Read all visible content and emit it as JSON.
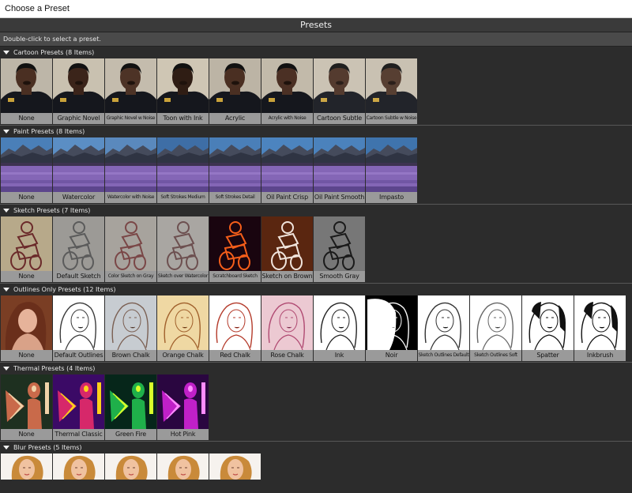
{
  "window": {
    "title": "Choose a Preset"
  },
  "panel": {
    "title": "Presets",
    "hint": "Double-click to select a preset."
  },
  "sections": [
    {
      "title": "Cartoon Presets (8 Items)",
      "items": [
        "None",
        "Graphic Novel",
        "Graphic Novel w Noise",
        "Toon with Ink",
        "Acrylic",
        "Acrylic with Noise",
        "Cartoon Subtle",
        "Cartoon Subtle w Noise"
      ]
    },
    {
      "title": "Paint Presets (8 Items)",
      "items": [
        "None",
        "Watercolor",
        "Watercolor with Noise",
        "Soft Strokes Medium",
        "Soft Strokes Detail",
        "Oil Paint Crisp",
        "Oil Paint Smooth",
        "Impasto"
      ]
    },
    {
      "title": "Sketch Presets (7 Items)",
      "items": [
        "None",
        "Default Sketch",
        "Color Sketch on Gray",
        "Sketch over Watercolor",
        "Scratchboard Sketch",
        "Sketch on Brown",
        "Smooth Gray"
      ]
    },
    {
      "title": "Outlines Only Presets (12 Items)",
      "items": [
        "None",
        "Default Outlines",
        "Brown Chalk",
        "Orange Chalk",
        "Red Chalk",
        "Rose Chalk",
        "Ink",
        "Noir",
        "Sketch Outlines Default",
        "Sketch Outlines Soft",
        "Spatter",
        "Inkbrush"
      ]
    },
    {
      "title": "Thermal Presets (4 Items)",
      "items": [
        "None",
        "Thermal Classic",
        "Green Fire",
        "Hot Pink"
      ]
    },
    {
      "title": "Blur Presets (5 Items)"
    }
  ],
  "colors": {
    "background": "#2c2c2c",
    "label_bg": "#9a9a9a",
    "header_bg": "#3a3a3a"
  }
}
